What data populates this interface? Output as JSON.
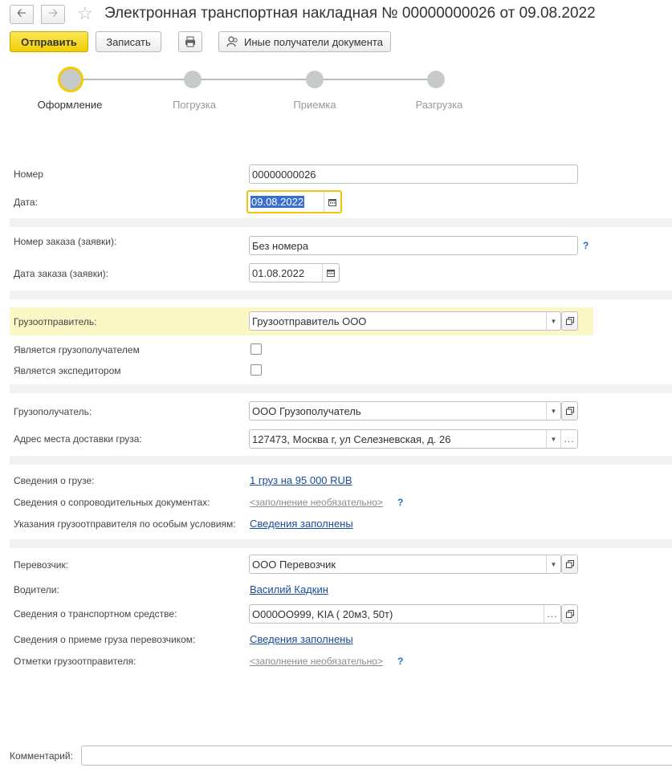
{
  "header": {
    "title": "Электронная транспортная накладная № 00000000026 от 09.08.2022"
  },
  "toolbar": {
    "send_label": "Отправить",
    "save_label": "Записать",
    "other_recipients_label": "Иные получатели документа"
  },
  "steps": [
    {
      "label": "Оформление"
    },
    {
      "label": "Погрузка"
    },
    {
      "label": "Приемка"
    },
    {
      "label": "Разгрузка"
    }
  ],
  "form": {
    "number": {
      "label": "Номер",
      "value": "00000000026"
    },
    "date": {
      "label": "Дата:",
      "value": "09.08.2022"
    },
    "order_number": {
      "label": "Номер заказа (заявки):",
      "value": "Без номера",
      "help": "?"
    },
    "order_date": {
      "label": "Дата заказа (заявки):",
      "value": "01.08.2022"
    },
    "shipper": {
      "label": "Грузоотправитель:",
      "value": "Грузоотправитель ООО"
    },
    "is_consignee": {
      "label": "Является грузополучателем",
      "checked": false
    },
    "is_forwarder": {
      "label": "Является экспедитором",
      "checked": false
    },
    "consignee": {
      "label": "Грузополучатель:",
      "value": "ООО Грузополучатель"
    },
    "delivery_address": {
      "label": "Адрес места доставки груза:",
      "value": "127473, Москва г, ул Селезневская, д. 26"
    },
    "cargo_info": {
      "label": "Сведения о грузе:",
      "link": "1 груз на 95 000 RUB"
    },
    "accompanying_docs": {
      "label": "Сведения о сопроводительных документах:",
      "link": "<заполнение необязательно>",
      "help": "?"
    },
    "shipper_instructions": {
      "label": "Указания грузоотправителя по особым условиям:",
      "link": "Сведения заполнены"
    },
    "carrier": {
      "label": "Перевозчик:",
      "value": "ООО Перевозчик"
    },
    "drivers": {
      "label": "Водители:",
      "link": "Василий Кадкин"
    },
    "vehicle": {
      "label": "Сведения о транспортном средстве:",
      "value": "О000ОО999, KIA ( 20м3, 50т)"
    },
    "carrier_acceptance": {
      "label": "Сведения о приеме груза перевозчиком:",
      "link": "Сведения заполнены"
    },
    "shipper_marks": {
      "label": "Отметки грузоотправителя:",
      "link": "<заполнение необязательно>",
      "help": "?"
    }
  },
  "comment": {
    "label": "Комментарий:",
    "value": ""
  },
  "colors": {
    "accent": "#f4cb00",
    "link": "#1a4b9a",
    "highlight": "#fbf8c5"
  }
}
